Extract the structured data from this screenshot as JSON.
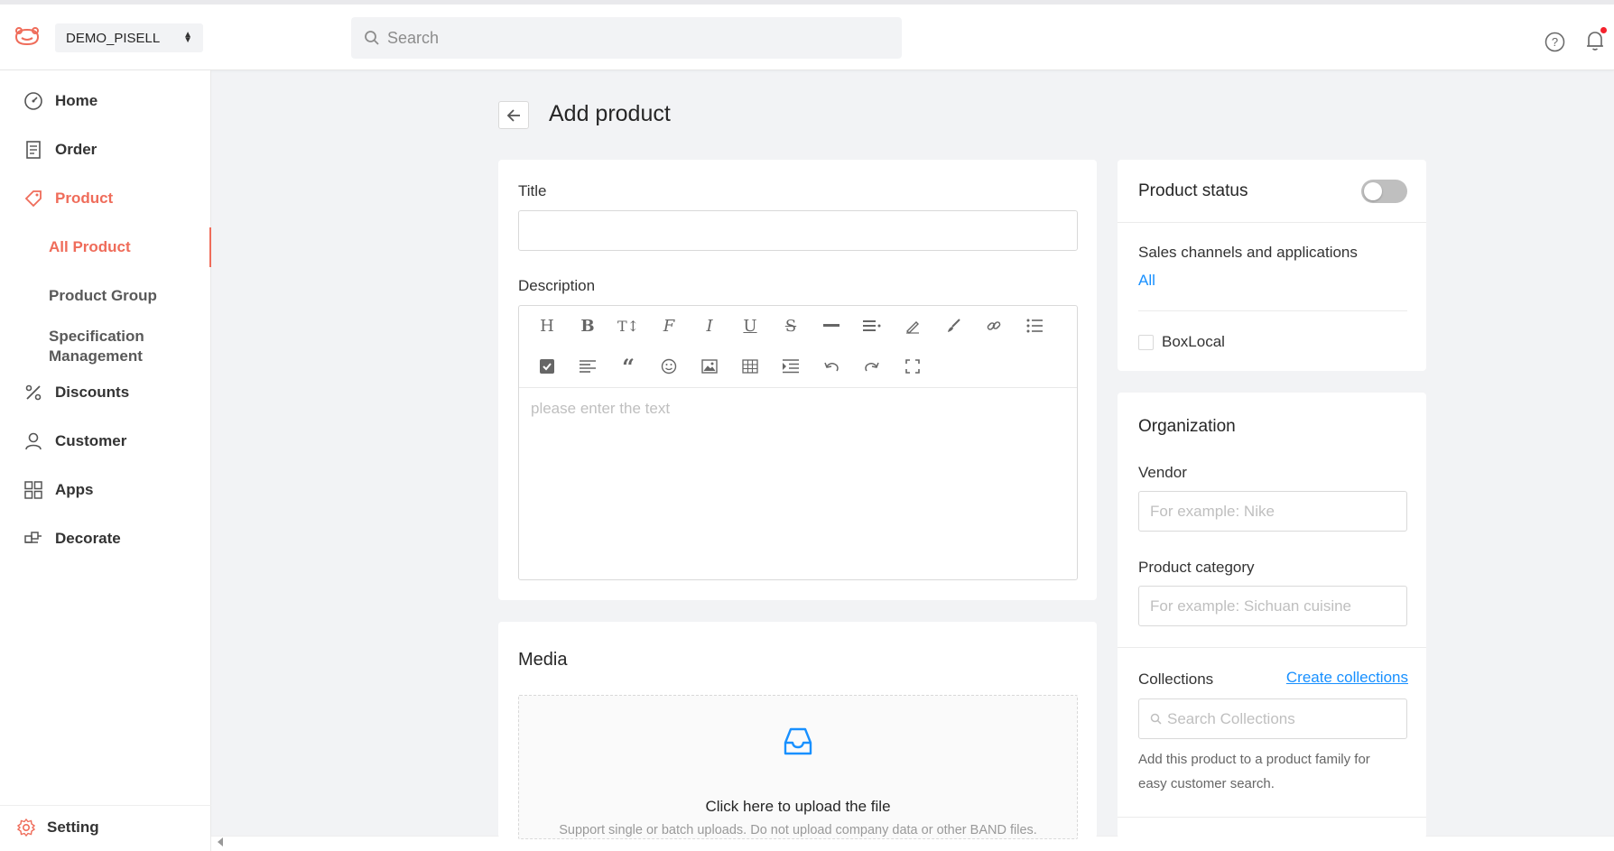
{
  "header": {
    "store_name": "DEMO_PISELL",
    "search_placeholder": "Search"
  },
  "sidebar": {
    "items": [
      {
        "label": "Home",
        "icon": "dashboard-icon"
      },
      {
        "label": "Order",
        "icon": "order-icon"
      },
      {
        "label": "Product",
        "icon": "tag-icon",
        "active": true
      },
      {
        "label": "Discounts",
        "icon": "percent-icon"
      },
      {
        "label": "Customer",
        "icon": "user-icon"
      },
      {
        "label": "Apps",
        "icon": "apps-icon"
      },
      {
        "label": "Decorate",
        "icon": "decorate-icon"
      }
    ],
    "product_sub": [
      {
        "label": "All Product",
        "active": true
      },
      {
        "label": "Product Group"
      },
      {
        "label": "Specification Management"
      }
    ],
    "setting_label": "Setting"
  },
  "page": {
    "title": "Add product"
  },
  "form": {
    "title_label": "Title",
    "title_value": "",
    "description_label": "Description",
    "editor_placeholder": "please enter the text",
    "media_title": "Media",
    "upload_text": "Click here to upload the file",
    "upload_hint": "Support single or batch uploads. Do not upload company data or other BAND files."
  },
  "status_panel": {
    "title": "Product status",
    "enabled": false,
    "channels_label": "Sales channels and applications",
    "channels_link": "All",
    "channel_option": "BoxLocal",
    "channel_checked": false
  },
  "organization": {
    "title": "Organization",
    "vendor_label": "Vendor",
    "vendor_placeholder": "For example: Nike",
    "category_label": "Product category",
    "category_placeholder": "For example: Sichuan cuisine",
    "collections_label": "Collections",
    "create_collections_link": "Create collections",
    "collections_placeholder": "Search Collections",
    "collections_help": "Add this product to a product family for easy customer search."
  },
  "colors": {
    "accent": "#ef6c5a",
    "link": "#1890ff",
    "background": "#f2f3f5"
  }
}
